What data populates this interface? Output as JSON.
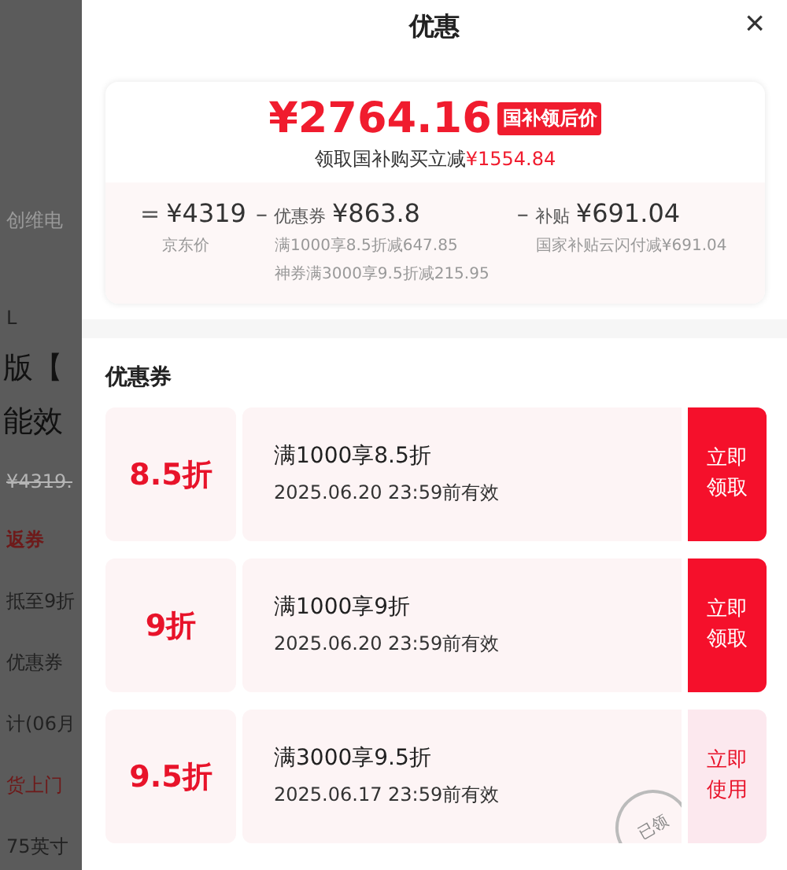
{
  "background_page": {
    "texts": [
      {
        "kind": "muted",
        "text": "创维电"
      },
      {
        "kind": "plain",
        "text": "L"
      },
      {
        "kind": "title",
        "text": "版【"
      },
      {
        "kind": "title",
        "text": "能效"
      },
      {
        "kind": "strike",
        "text": "¥4319."
      },
      {
        "kind": "tag",
        "text": "返券"
      },
      {
        "kind": "plain",
        "text": "抵至9折"
      },
      {
        "kind": "plain",
        "text": "优惠券"
      },
      {
        "kind": "plain",
        "text": "计(06月"
      },
      {
        "kind": "red",
        "text": "货上门"
      },
      {
        "kind": "plain",
        "text": "75英寸"
      }
    ]
  },
  "sheet": {
    "title": "优惠",
    "close": "×"
  },
  "summary": {
    "price": "¥2764.16",
    "price_tag": "国补领后价",
    "saving_label": "领取国补购买立减",
    "saving": "¥1554.84",
    "parts": [
      {
        "op": "=",
        "amount": "¥4319",
        "notes": [
          "京东价"
        ]
      },
      {
        "op": "–",
        "label": "优惠券",
        "amount": "¥863.8",
        "notes": [
          "满1000享8.5折减647.85",
          "神券满3000享9.5折减215.95"
        ]
      },
      {
        "op": "–",
        "label": "补贴",
        "amount": "¥691.04",
        "notes": [
          "国家补贴云闪付减¥691.04"
        ]
      }
    ]
  },
  "coupons_section": {
    "title": "优惠券",
    "coupons": [
      {
        "discount": "8.5折",
        "condition": "满1000享8.5折",
        "validity": "2025.06.20 23:59前有效",
        "action": "立即领取",
        "claimed": false
      },
      {
        "discount": "9折",
        "condition": "满1000享9折",
        "validity": "2025.06.20 23:59前有效",
        "action": "立即领取",
        "claimed": false
      },
      {
        "discount": "9.5折",
        "condition": "满3000享9.5折",
        "validity": "2025.06.17 23:59前有效",
        "action": "立即使用",
        "claimed": true,
        "stamp": "已领"
      }
    ]
  }
}
